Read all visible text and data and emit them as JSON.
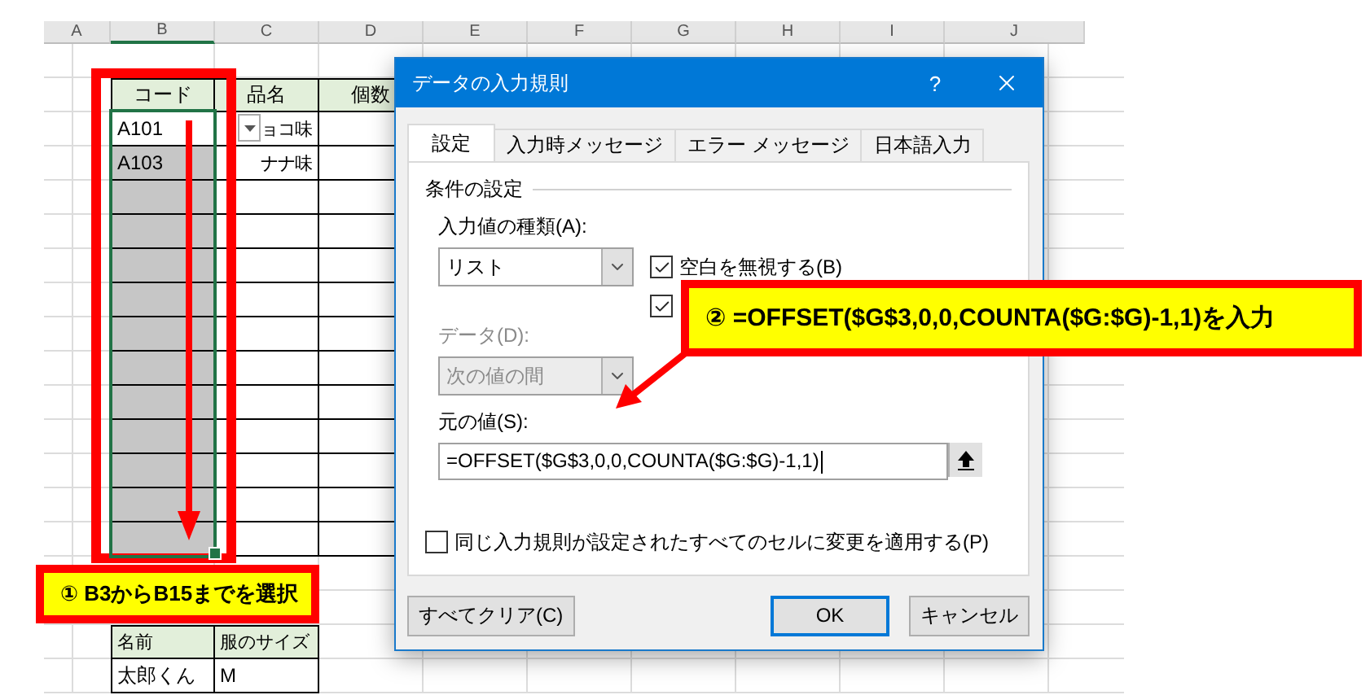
{
  "sheet": {
    "columns": [
      "A",
      "B",
      "C",
      "D",
      "E",
      "F",
      "G",
      "H",
      "I",
      "J"
    ],
    "table1": {
      "headers": [
        "コード",
        "品名",
        "個数"
      ],
      "rows": [
        {
          "code": "A101",
          "name": "ョコ味",
          "selected": true,
          "active": true
        },
        {
          "code": "A103",
          "name": "ナナ味",
          "selected": true,
          "active": false
        },
        {
          "selected": true,
          "active": false
        },
        {
          "selected": true,
          "active": false
        },
        {
          "selected": true,
          "active": false
        },
        {
          "selected": true,
          "active": false
        },
        {
          "selected": true,
          "active": false
        },
        {
          "selected": true,
          "active": false
        },
        {
          "selected": true,
          "active": false
        },
        {
          "selected": true,
          "active": false
        },
        {
          "selected": true,
          "active": false
        },
        {
          "selected": true,
          "active": false
        },
        {
          "selected": true,
          "active": false
        }
      ]
    },
    "table2": {
      "headers": [
        "名前",
        "服のサイズ"
      ],
      "rows": [
        [
          "太郎くん",
          "M"
        ]
      ]
    }
  },
  "dialog": {
    "title": "データの入力規則",
    "help": "?",
    "tabs": [
      {
        "label": "設定",
        "selected": true
      },
      {
        "label": "入力時メッセージ",
        "selected": false
      },
      {
        "label": "エラー メッセージ",
        "selected": false
      },
      {
        "label": "日本語入力",
        "selected": false
      }
    ],
    "group_title": "条件の設定",
    "type_label": "入力値の種類(A):",
    "type_value": "リスト",
    "checkboxes": [
      {
        "label": "空白を無視する(B)",
        "checked": true
      },
      {
        "checked": true
      }
    ],
    "data_label": "データ(D):",
    "data_value": "次の値の間",
    "data_disabled": true,
    "source_label": "元の値(S):",
    "source_value": "=OFFSET($G$3,0,0,COUNTA($G:$G)-1,1)",
    "apply_all": {
      "label": "同じ入力規則が設定されたすべてのセルに変更を適用する(P)",
      "checked": false
    },
    "buttons": [
      {
        "label": "すべてクリア(C)",
        "kind": "clear",
        "default": false
      },
      {
        "label": "OK",
        "kind": "ok",
        "default": true
      },
      {
        "label": "キャンセル",
        "kind": "cancel",
        "default": false
      }
    ]
  },
  "callouts": [
    {
      "kind": "step1",
      "text": "① B3からB15までを選択"
    },
    {
      "kind": "step2",
      "text": "② =OFFSET($G$3,0,0,COUNTA($G:$G)-1,1)を入力"
    }
  ]
}
